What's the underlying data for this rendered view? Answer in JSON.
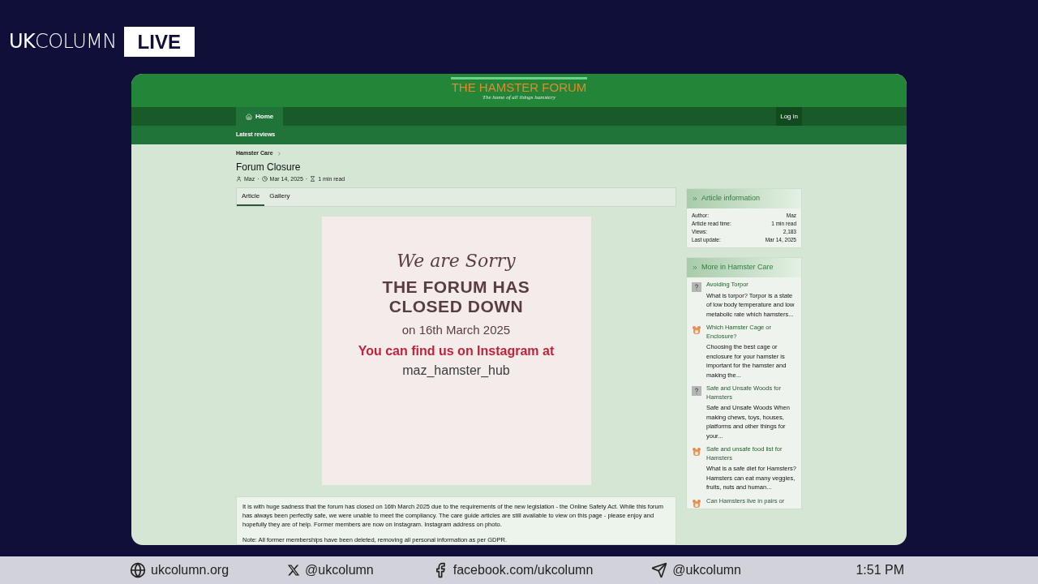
{
  "broadcast": {
    "logo": "**UK**COLUMN",
    "live_badge": "LIVE"
  },
  "site": {
    "title": "THE HAMSTER FORUM",
    "tagline": "The home of all things hamstery"
  },
  "nav": {
    "items": [
      {
        "label": "Home",
        "selected": true
      }
    ],
    "login": "Log in"
  },
  "subnav": {
    "items": [
      "Latest reviews"
    ]
  },
  "breadcrumb": [
    "Hamster Care"
  ],
  "article": {
    "title": "Forum Closure",
    "author": "Maz",
    "date": "Mar 14, 2025",
    "read_time": "1 min read",
    "meta_separator": "·",
    "tabs": [
      {
        "label": "Article",
        "selected": true
      },
      {
        "label": "Gallery",
        "selected": false
      }
    ],
    "notice": {
      "kind": "picture-text",
      "script": "We are Sorry",
      "headline": "THE FORUM HAS CLOSED DOWN",
      "date": "on 16th March 2025",
      "call": "You can find us on Instagram at",
      "handle": "maz_hamster_hub"
    },
    "body": "It is with huge sadness that the forum has closed on 16th March 2025 due to the requirements of the new legislation - the Online Safety Act. While this forum has always been perfectly safe, we were unable to meet the compliancy. The care guide articles are still available to view on this page - please enjoy and hopefully they are of help. Former members are now on Instagram. Instagram address on photo.",
    "note": "Note: All former memberships have been deleted, removing all personal information as per GDPR."
  },
  "article_info": {
    "title": "Article information",
    "rows": [
      {
        "label": "Author:",
        "value": "Maz"
      },
      {
        "label": "Article read time:",
        "value": "1 min read"
      },
      {
        "label": "Views:",
        "value": "2,183"
      },
      {
        "label": "Last update:",
        "value": "Mar 14, 2025"
      }
    ]
  },
  "more": {
    "title": "More in Hamster Care",
    "items": [
      {
        "kind": "question",
        "title": "Avoiding Torpor",
        "snippet": "What is torpor? Torpor is a state of low body temperature and low metabolic rate which hamsters..."
      },
      {
        "kind": "hamster",
        "title": "Which Hamster Cage or Enclosure?",
        "snippet": "Choosing the best cage or enclosure for your hamster is important for the hamster and making the..."
      },
      {
        "kind": "question",
        "title": "Safe and Unsafe Woods for Hamsters",
        "snippet": "Safe and Unsafe Woods When making chews, toys, houses, platforms and other things for your..."
      },
      {
        "kind": "hamster",
        "title": "Safe and unsafe food list for Hamsters",
        "snippet": "What is a safe diet for Hamsters? Hamsters can eat many veggies, fruits, nuts and human..."
      },
      {
        "kind": "hamster",
        "title": "Can Hamsters live in pairs or"
      }
    ]
  },
  "footer": [
    {
      "kind": "web",
      "text": "ukcolumn.org"
    },
    {
      "kind": "x",
      "text": "@ukcolumn"
    },
    {
      "kind": "facebook",
      "text": "facebook.com/ukcolumn"
    },
    {
      "kind": "telegram",
      "text": "@ukcolumn"
    }
  ],
  "clock": "1:51 PM"
}
